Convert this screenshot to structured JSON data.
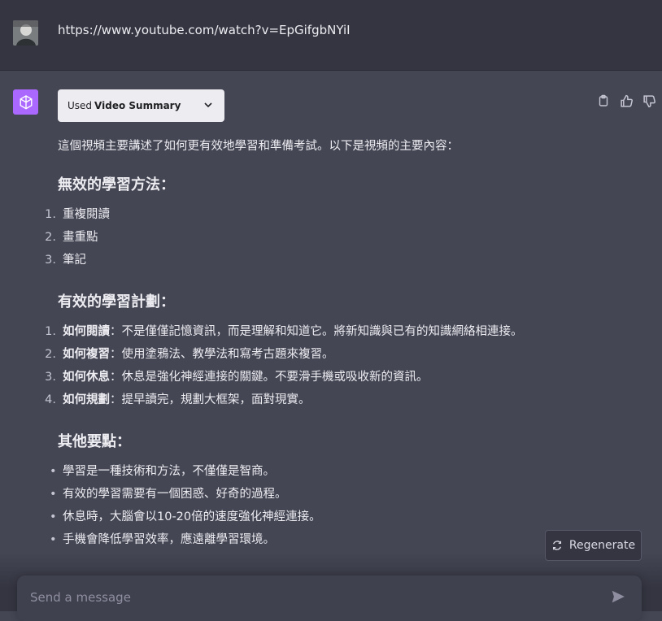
{
  "user_message": {
    "avatar": "user-avatar",
    "text": "https://www.youtube.com/watch?v=EpGifgbNYiI"
  },
  "assistant": {
    "avatar": "openai-logo-icon",
    "plugin_chip": {
      "prefix": "Used",
      "name": "Video Summary"
    },
    "intro": "這個視頻主要講述了如何更有效地學習和準備考試。以下是視頻的主要內容：",
    "sections": [
      {
        "title": "無效的學習方法：",
        "items": [
          {
            "num": "1.",
            "text": "重複閱讀"
          },
          {
            "num": "2.",
            "text": "畫重點"
          },
          {
            "num": "3.",
            "text": "筆記"
          }
        ]
      },
      {
        "title": "有效的學習計劃：",
        "items": [
          {
            "num": "1.",
            "bold": "如何閱讀",
            "text": "：不是僅僅記憶資訊，而是理解和知道它。將新知識與已有的知識網絡相連接。"
          },
          {
            "num": "2.",
            "bold": "如何複習",
            "text": "：使用塗鴉法、教學法和寫考古題來複習。"
          },
          {
            "num": "3.",
            "bold": "如何休息",
            "text": "：休息是強化神經連接的關鍵。不要滑手機或吸收新的資訊。"
          },
          {
            "num": "4.",
            "bold": "如何規劃",
            "text": "：提早讀完，規劃大框架，面對現實。"
          }
        ]
      },
      {
        "title": "其他要點：",
        "items": [
          {
            "bullet": "•",
            "text": "學習是一種技術和方法，不僅僅是智商。"
          },
          {
            "bullet": "•",
            "text": "有效的學習需要有一個困惑、好奇的過程。"
          },
          {
            "bullet": "•",
            "text": "休息時，大腦會以10-20倍的速度強化神經連接。"
          },
          {
            "bullet": "•",
            "text": "手機會降低學習效率，應遠離學習環境。"
          }
        ]
      }
    ]
  },
  "controls": {
    "regenerate_label": "Regenerate",
    "input_placeholder": "Send a message"
  },
  "colors": {
    "plugin_logo_bg": "#ab68ff",
    "chat_bg": "#444654",
    "user_bg": "#343541"
  }
}
